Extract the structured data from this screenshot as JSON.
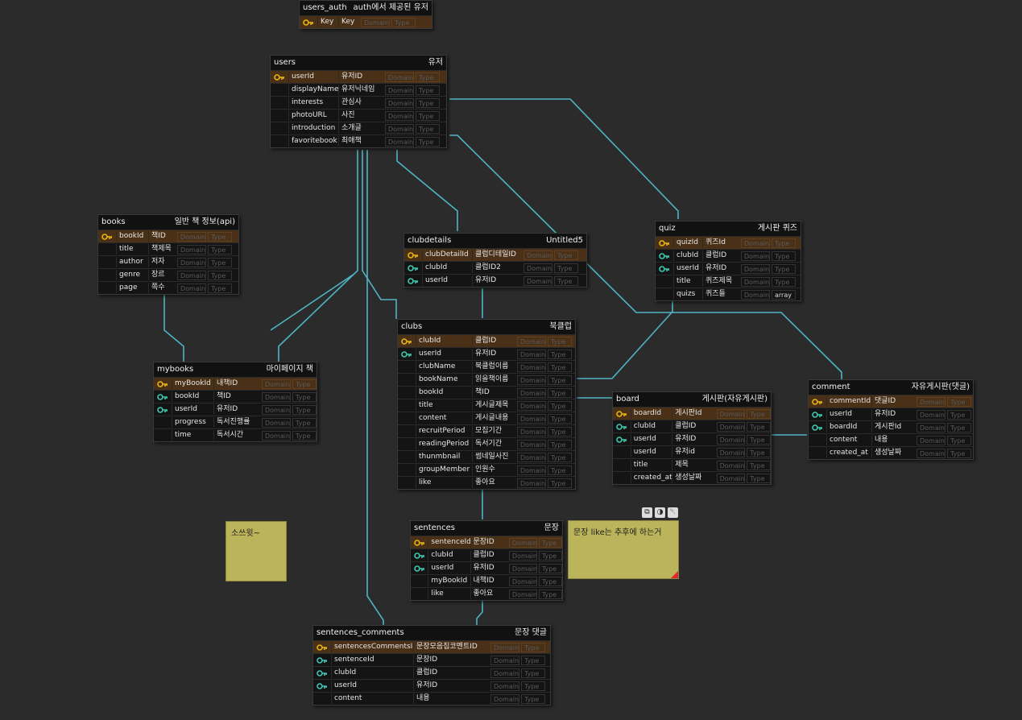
{
  "colors": {
    "background": "#2b2b2b",
    "connector": "#4fb4c4",
    "pk_key": "#e8b414",
    "fk_key": "#3ec6b0",
    "key_row": "#4a3017",
    "note": "#bcb45a"
  },
  "tables": [
    {
      "id": "users_auth",
      "name": "users_auth",
      "logical": "auth에서 제공된 유저",
      "cols": [
        {
          "k": "pk",
          "name": "Key",
          "logical": "Key",
          "domain": "Domain",
          "type": "Type"
        }
      ]
    },
    {
      "id": "users",
      "name": "users",
      "logical": "유저",
      "cols": [
        {
          "k": "pk",
          "name": "userId",
          "logical": "유저ID",
          "domain": "Domain",
          "type": "Type"
        },
        {
          "k": "",
          "name": "displayName",
          "logical": "유저닉네임",
          "domain": "Domain",
          "type": "Type"
        },
        {
          "k": "",
          "name": "interests",
          "logical": "관심사",
          "domain": "Domain",
          "type": "Type"
        },
        {
          "k": "",
          "name": "photoURL",
          "logical": "사진",
          "domain": "Domain",
          "type": "Type"
        },
        {
          "k": "",
          "name": "introduction",
          "logical": "소개글",
          "domain": "Domain",
          "type": "Type"
        },
        {
          "k": "",
          "name": "favoritebook",
          "logical": "최애책",
          "domain": "Domain",
          "type": "Type"
        }
      ]
    },
    {
      "id": "books",
      "name": "books",
      "logical": "일반 책 정보(api)",
      "cols": [
        {
          "k": "pk",
          "name": "bookId",
          "logical": "책ID",
          "domain": "Domain",
          "type": "Type"
        },
        {
          "k": "",
          "name": "title",
          "logical": "책제목",
          "domain": "Domain",
          "type": "Type"
        },
        {
          "k": "",
          "name": "author",
          "logical": "저자",
          "domain": "Domain",
          "type": "Type"
        },
        {
          "k": "",
          "name": "genre",
          "logical": "장르",
          "domain": "Domain",
          "type": "Type"
        },
        {
          "k": "",
          "name": "page",
          "logical": "쪽수",
          "domain": "Domain",
          "type": "Type"
        }
      ]
    },
    {
      "id": "clubdetails",
      "name": "clubdetails",
      "logical": "Untitled5",
      "cols": [
        {
          "k": "pk",
          "name": "clubDetailId",
          "logical": "클럽디테일ID",
          "domain": "Domain",
          "type": "Type"
        },
        {
          "k": "fk",
          "name": "clubId",
          "logical": "클럽ID2",
          "domain": "Domain",
          "type": "Type"
        },
        {
          "k": "fk",
          "name": "userId",
          "logical": "유저ID",
          "domain": "Domain",
          "type": "Type"
        }
      ]
    },
    {
      "id": "quiz",
      "name": "quiz",
      "logical": "게시판 퀴즈",
      "cols": [
        {
          "k": "pk",
          "name": "quizId",
          "logical": "퀴즈Id",
          "domain": "Domain",
          "type": "Type"
        },
        {
          "k": "fk",
          "name": "clubId",
          "logical": "클럽ID",
          "domain": "Domain",
          "type": "Type"
        },
        {
          "k": "fk",
          "name": "userId",
          "logical": "유저ID",
          "domain": "Domain",
          "type": "Type"
        },
        {
          "k": "",
          "name": "title",
          "logical": "퀴즈제목",
          "domain": "Domain",
          "type": "Type"
        },
        {
          "k": "",
          "name": "quizs",
          "logical": "퀴즈들",
          "domain": "Domain",
          "type": "array"
        }
      ]
    },
    {
      "id": "clubs",
      "name": "clubs",
      "logical": "북클럽",
      "cols": [
        {
          "k": "pk",
          "name": "clubId",
          "logical": "클럽ID",
          "domain": "Domain",
          "type": "Type"
        },
        {
          "k": "fk",
          "name": "userId",
          "logical": "유저ID",
          "domain": "Domain",
          "type": "Type"
        },
        {
          "k": "",
          "name": "clubName",
          "logical": "북클럽이름",
          "domain": "Domain",
          "type": "Type"
        },
        {
          "k": "",
          "name": "bookName",
          "logical": "읽을책이름",
          "domain": "Domain",
          "type": "Type"
        },
        {
          "k": "",
          "name": "bookId",
          "logical": "책ID",
          "domain": "Domain",
          "type": "Type"
        },
        {
          "k": "",
          "name": "title",
          "logical": "게시글제목",
          "domain": "Domain",
          "type": "Type"
        },
        {
          "k": "",
          "name": "content",
          "logical": "게시글내용",
          "domain": "Domain",
          "type": "Type"
        },
        {
          "k": "",
          "name": "recruitPeriod",
          "logical": "모집기간",
          "domain": "Domain",
          "type": "Type"
        },
        {
          "k": "",
          "name": "readingPeriod",
          "logical": "독서기간",
          "domain": "Domain",
          "type": "Type"
        },
        {
          "k": "",
          "name": "thunmbnail",
          "logical": "썸네일사진",
          "domain": "Domain",
          "type": "Type"
        },
        {
          "k": "",
          "name": "groupMember",
          "logical": "인원수",
          "domain": "Domain",
          "type": "Type"
        },
        {
          "k": "",
          "name": "like",
          "logical": "좋아요",
          "domain": "Domain",
          "type": "Type"
        }
      ]
    },
    {
      "id": "mybooks",
      "name": "mybooks",
      "logical": "마이페이지 책",
      "cols": [
        {
          "k": "pk",
          "name": "myBookId",
          "logical": "내책ID",
          "domain": "Domain",
          "type": "Type"
        },
        {
          "k": "fk",
          "name": "bookId",
          "logical": "책ID",
          "domain": "Domain",
          "type": "Type"
        },
        {
          "k": "fk",
          "name": "userId",
          "logical": "유저ID",
          "domain": "Domain",
          "type": "Type"
        },
        {
          "k": "",
          "name": "progress",
          "logical": "독서진행률",
          "domain": "Domain",
          "type": "Type"
        },
        {
          "k": "",
          "name": "time",
          "logical": "독서시간",
          "domain": "Domain",
          "type": "Type"
        }
      ]
    },
    {
      "id": "board",
      "name": "board",
      "logical": "게시판(자유게시판)",
      "cols": [
        {
          "k": "pk",
          "name": "boardId",
          "logical": "게시판Id",
          "domain": "Domain",
          "type": "Type"
        },
        {
          "k": "fk",
          "name": "clubId",
          "logical": "클럽ID",
          "domain": "Domain",
          "type": "Type"
        },
        {
          "k": "fk",
          "name": "userId",
          "logical": "유저ID",
          "domain": "Domain",
          "type": "Type"
        },
        {
          "k": "",
          "name": "userId",
          "logical": "유저id",
          "domain": "Domain",
          "type": "Type"
        },
        {
          "k": "",
          "name": "title",
          "logical": "제목",
          "domain": "Domain",
          "type": "Type"
        },
        {
          "k": "",
          "name": "created_at",
          "logical": "생성날짜",
          "domain": "Domain",
          "type": "Type"
        }
      ]
    },
    {
      "id": "comment",
      "name": "comment",
      "logical": "자유게시판(댓글)",
      "cols": [
        {
          "k": "pk",
          "name": "commentId",
          "logical": "댓글ID",
          "domain": "Domain",
          "type": "Type"
        },
        {
          "k": "fk",
          "name": "userId",
          "logical": "유저ID",
          "domain": "Domain",
          "type": "Type"
        },
        {
          "k": "fk",
          "name": "boardId",
          "logical": "게시판Id",
          "domain": "Domain",
          "type": "Type"
        },
        {
          "k": "",
          "name": "content",
          "logical": "내용",
          "domain": "Domain",
          "type": "Type"
        },
        {
          "k": "",
          "name": "created_at",
          "logical": "생성날짜",
          "domain": "Domain",
          "type": "Type"
        }
      ]
    },
    {
      "id": "sentences",
      "name": "sentences",
      "logical": "문장",
      "cols": [
        {
          "k": "pk",
          "name": "sentenceId",
          "logical": "문장ID",
          "domain": "Domain",
          "type": "Type"
        },
        {
          "k": "fk",
          "name": "clubId",
          "logical": "클럽ID",
          "domain": "Domain",
          "type": "Type"
        },
        {
          "k": "fk",
          "name": "userId",
          "logical": "유저ID",
          "domain": "Domain",
          "type": "Type"
        },
        {
          "k": "",
          "name": "myBookId",
          "logical": "내책ID",
          "domain": "Domain",
          "type": "Type"
        },
        {
          "k": "",
          "name": "like",
          "logical": "좋아요",
          "domain": "Domain",
          "type": "Type"
        }
      ]
    },
    {
      "id": "sentences_comments",
      "name": "sentences_comments",
      "logical": "문장 댓글",
      "cols": [
        {
          "k": "pk",
          "name": "sentencesCommentsId",
          "logical": "문장모음집코멘트ID",
          "domain": "Domain",
          "type": "Type"
        },
        {
          "k": "fk",
          "name": "sentenceId",
          "logical": "문장ID",
          "domain": "Domain",
          "type": "Type"
        },
        {
          "k": "fk",
          "name": "clubId",
          "logical": "클럽ID",
          "domain": "Domain",
          "type": "Type"
        },
        {
          "k": "fk",
          "name": "userId",
          "logical": "유저ID",
          "domain": "Domain",
          "type": "Type"
        },
        {
          "k": "",
          "name": "content",
          "logical": "내용",
          "domain": "Domain",
          "type": "Type"
        }
      ]
    }
  ],
  "notes": [
    {
      "id": "note1",
      "text": "소쓰윗~"
    },
    {
      "id": "note2",
      "text": "문장 like는 추후에 하는거"
    }
  ],
  "note_tools": {
    "copy_icon": "copy-icon",
    "palette_icon": "palette-icon",
    "delete_icon": "trash-icon"
  }
}
